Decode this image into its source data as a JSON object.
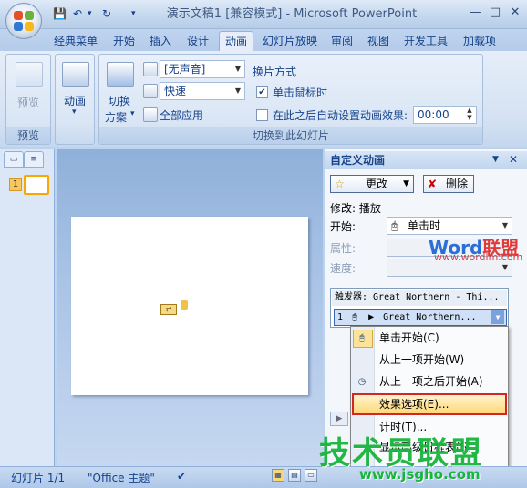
{
  "window": {
    "title": "演示文稿1 [兼容模式] - Microsoft PowerPoint",
    "controls": {
      "minimize": "—",
      "maximize": "□",
      "close": "✕"
    }
  },
  "quick_access": {
    "save": "💾",
    "undo": "↶",
    "undo_drop": "▾",
    "redo": "↻",
    "customize": "▾"
  },
  "tabs": [
    "经典菜单",
    "开始",
    "插入",
    "设计",
    "动画",
    "幻灯片放映",
    "审阅",
    "视图",
    "开发工具",
    "加载项"
  ],
  "active_tab": "动画",
  "ribbon": {
    "preview_group": {
      "button": "预览",
      "label": "预览"
    },
    "animation_group": {
      "button": "动画",
      "dropdown": "▾"
    },
    "transition_group": {
      "scheme_line1": "切换",
      "scheme_line2": "方案",
      "scheme_arrow": "▾",
      "sound": "[无声音]",
      "speed": "快速",
      "apply_all": "全部应用",
      "advance_title": "换片方式",
      "on_click": "单击鼠标时",
      "on_click_checked": true,
      "auto_after": "在此之后自动设置动画效果:",
      "auto_after_checked": false,
      "auto_time": "00:00",
      "label": "切换到此幻灯片"
    }
  },
  "slides_panel": {
    "tab_slides": "▭",
    "tab_outline": "≡",
    "slide_number": "1"
  },
  "task_pane": {
    "title": "自定义动画",
    "menu_arrow": "▼",
    "close": "✕",
    "change_button": "更改",
    "delete_button": "删除",
    "modify_label": "修改: 播放",
    "start_label": "开始:",
    "start_value": "单击时",
    "property_label": "属性:",
    "speed_label": "速度:",
    "trigger_row": "触发器: Great Northern - Thi...",
    "effect_index": "1",
    "effect_name": "Great Northern...",
    "play_icon": "▶",
    "re_order_arrow": "▶"
  },
  "context_menu": {
    "items": [
      {
        "label": "单击开始(C)",
        "icon": "mouse-icon"
      },
      {
        "label": "从上一项开始(W)",
        "icon": ""
      },
      {
        "label": "从上一项之后开始(A)",
        "icon": "clock-icon"
      },
      {
        "label": "效果选项(E)...",
        "icon": "",
        "highlighted": true
      },
      {
        "label": "计时(T)...",
        "icon": ""
      },
      {
        "label": "显示高级日程表(S)",
        "icon": ""
      }
    ]
  },
  "statusbar": {
    "slide": "幻灯片 1/1",
    "theme": "\"Office 主题\"",
    "spell": "✔"
  },
  "watermarks": {
    "word": "Word",
    "lianmeng": "联盟",
    "word_url": "www.wordlm.com",
    "big": "技术员联盟",
    "site": "www.jsgho.com"
  },
  "colors": {
    "accent": "#15428b",
    "highlight_border": "#d52626",
    "watermark_green": "#17b53c"
  }
}
